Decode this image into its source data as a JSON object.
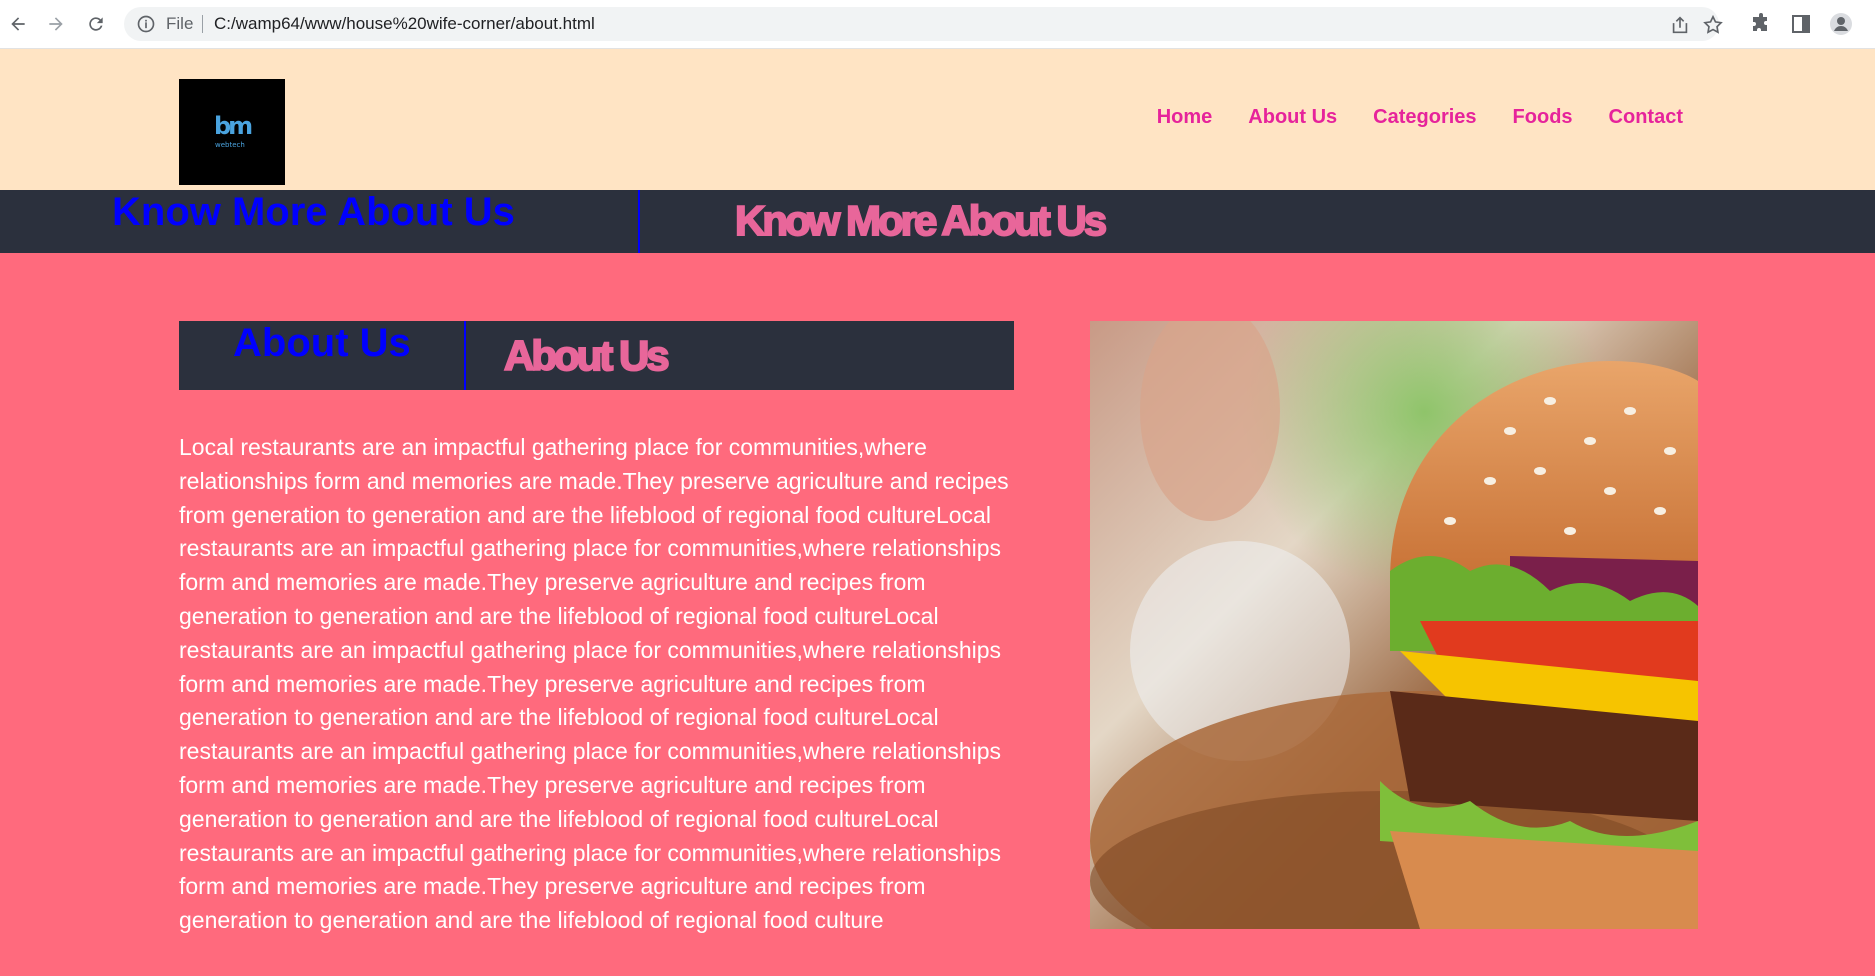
{
  "browser": {
    "scheme_label": "File",
    "url": "C:/wamp64/www/house%20wife-corner/about.html"
  },
  "site": {
    "logo_mark": "bm",
    "logo_sub": "webtech",
    "nav": [
      "Home",
      "About Us",
      "Categories",
      "Foods",
      "Contact"
    ]
  },
  "banner": {
    "title": "Know More About Us",
    "title_outline": "Know More About Us"
  },
  "about": {
    "title": "About Us",
    "title_outline": "About Us",
    "text": "Local restaurants are an impactful gathering place for communities,where relationships form and memories are made.They preserve agriculture and recipes from generation to generation and are the lifeblood of regional food cultureLocal restaurants are an impactful gathering place for communities,where relationships form and memories are made.They preserve agriculture and recipes from generation to generation and are the lifeblood of regional food cultureLocal restaurants are an impactful gathering place for communities,where relationships form and memories are made.They preserve agriculture and recipes from generation to generation and are the lifeblood of regional food cultureLocal restaurants are an impactful gathering place for communities,where relationships form and memories are made.They preserve agriculture and recipes from generation to generation and are the lifeblood of regional food cultureLocal restaurants are an impactful gathering place for communities,where relationships form and memories are made.They preserve agriculture and recipes from generation to generation and are the lifeblood of regional food culture"
  },
  "colors": {
    "header_bg": "#ffe4c4",
    "nav_link": "#e6239b",
    "banner_bg": "#2b303d",
    "heading_blue": "#0000ff",
    "outline_pink": "#e8669a",
    "main_bg": "#ff6a7d"
  }
}
